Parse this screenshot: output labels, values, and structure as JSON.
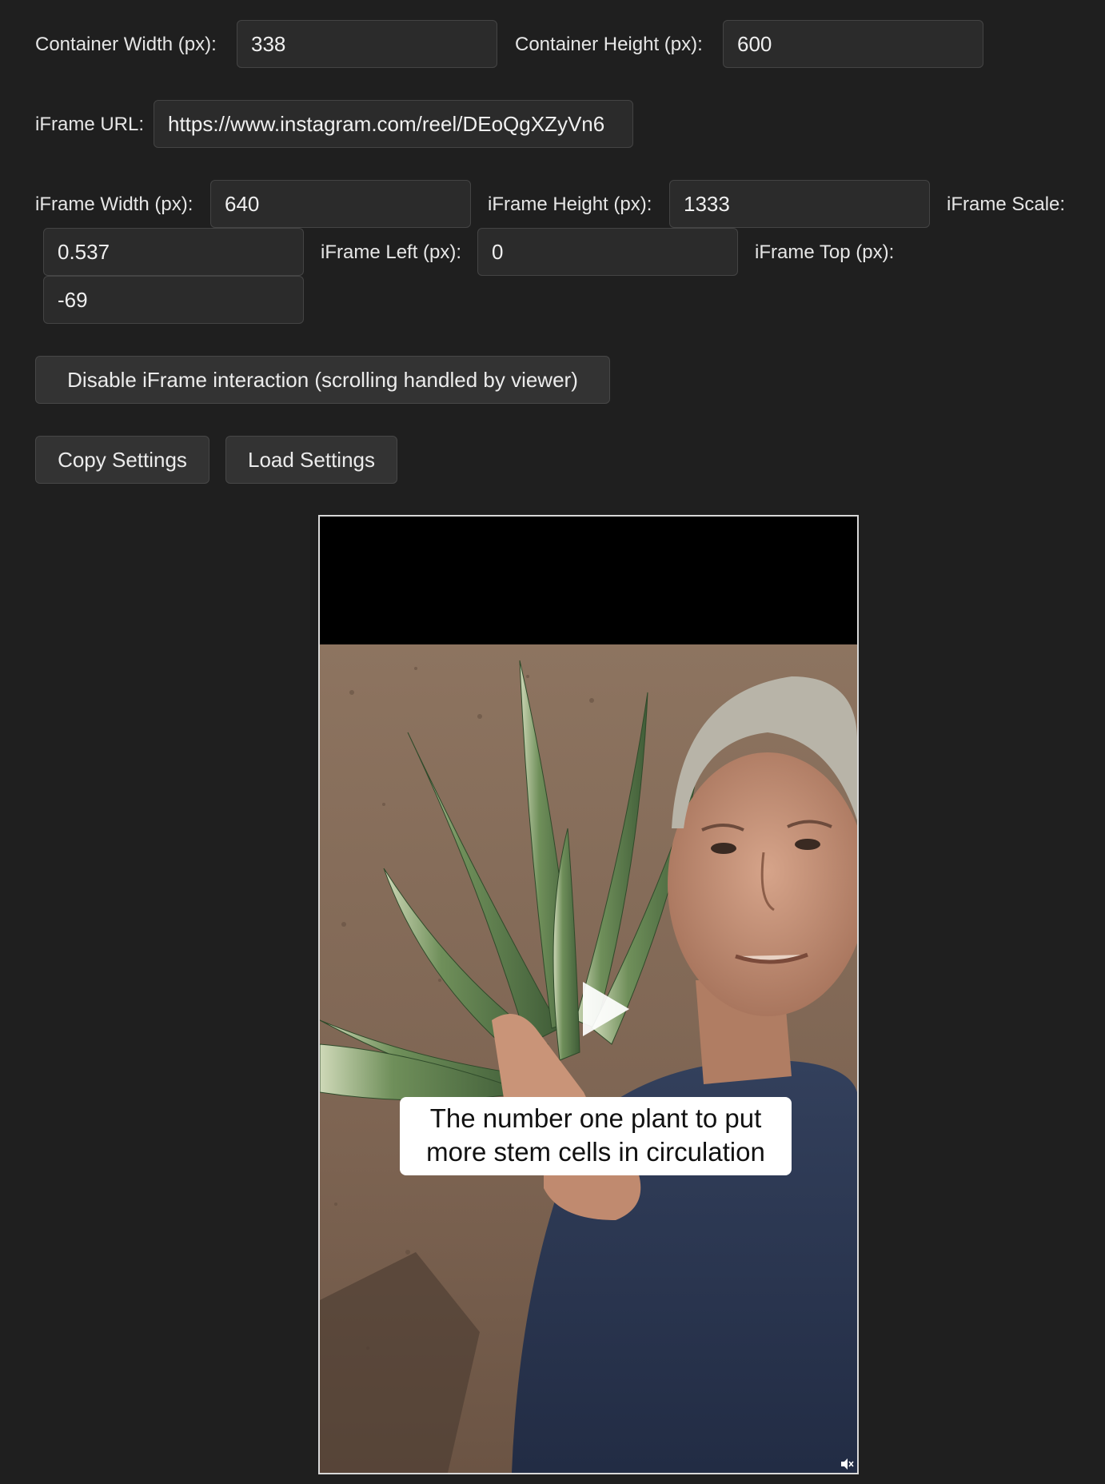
{
  "controls": {
    "container_width": {
      "label": "Container Width (px):",
      "value": "338"
    },
    "container_height": {
      "label": "Container Height (px):",
      "value": "600"
    },
    "iframe_url": {
      "label": "iFrame URL:",
      "value": "https://www.instagram.com/reel/DEoQgXZyVn6"
    },
    "iframe_width": {
      "label": "iFrame Width (px):",
      "value": "640"
    },
    "iframe_height": {
      "label": "iFrame Height (px):",
      "value": "1333"
    },
    "iframe_scale": {
      "label": "iFrame Scale:",
      "value": "0.537"
    },
    "iframe_left": {
      "label": "iFrame Left (px):",
      "value": "0"
    },
    "iframe_top": {
      "label": "iFrame Top (px):",
      "value": "-69"
    }
  },
  "buttons": {
    "disable_interaction": "Disable iFrame interaction (scrolling handled by viewer)",
    "copy_settings": "Copy Settings",
    "load_settings": "Load Settings"
  },
  "viewer": {
    "caption_line1": "The number one plant to put",
    "caption_line2": "more stem cells in circulation",
    "icons": [
      "play-icon",
      "mute-icon"
    ]
  },
  "colors": {
    "background": "#1f1f1f",
    "field_bg": "#2b2b2b",
    "button_bg": "#333333",
    "text": "#e8e8e8"
  }
}
